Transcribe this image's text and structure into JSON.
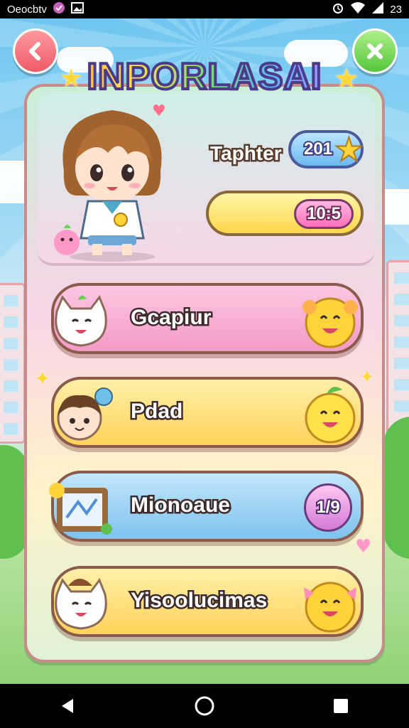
{
  "status_bar": {
    "left_text": "Oeocbtv",
    "time": "23",
    "icons": [
      "notification-icon",
      "image-icon",
      "alarm-icon",
      "wifi-icon",
      "signal-icon"
    ]
  },
  "header": {
    "title": "INPORLASAI",
    "back_icon": "chevron-left-icon",
    "close_icon": "close-icon"
  },
  "profile": {
    "player_label": "Taphter",
    "level_value": "201",
    "timer_value": "10:5"
  },
  "menu": {
    "items": [
      {
        "label": "Gcapiur",
        "color": "#f7a9d0",
        "badge": ""
      },
      {
        "label": "Pdad",
        "color": "#ffe27a",
        "badge": ""
      },
      {
        "label": "Mionoaue",
        "color": "#9fd6f7",
        "badge": "1/9"
      },
      {
        "label": "Yisoolucimas",
        "color": "#ffe27a",
        "badge": ""
      }
    ]
  },
  "colors": {
    "pink": "#f7a9d0",
    "yellow": "#ffe27a",
    "blue": "#9fd6f7",
    "outline": "#8b5a4a"
  }
}
